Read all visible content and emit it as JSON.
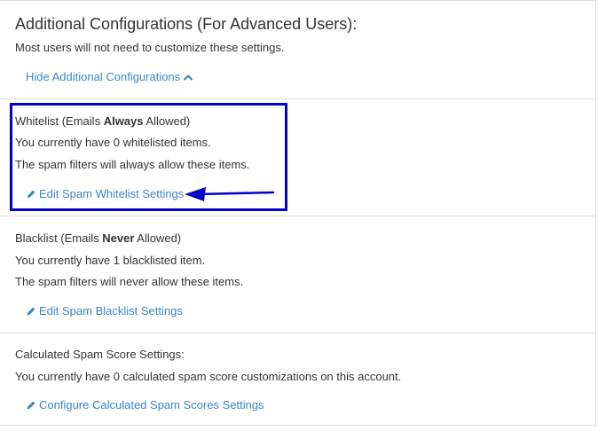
{
  "header": {
    "title": "Additional Configurations (For Advanced Users):",
    "description": "Most users will not need to customize these settings.",
    "toggle_link": "Hide Additional Configurations"
  },
  "whitelist": {
    "heading_pre": "Whitelist (Emails ",
    "heading_bold": "Always",
    "heading_post": " Allowed)",
    "count_text": "You currently have 0 whitelisted items.",
    "info_text": "The spam filters will always allow these items.",
    "link": "Edit Spam Whitelist Settings"
  },
  "blacklist": {
    "heading_pre": "Blacklist (Emails ",
    "heading_bold": "Never",
    "heading_post": " Allowed)",
    "count_text": "You currently have 1 blacklisted item.",
    "info_text": "The spam filters will never allow these items.",
    "link": "Edit Spam Blacklist Settings"
  },
  "calculated": {
    "heading": "Calculated Spam Score Settings:",
    "count_text": "You currently have 0 calculated spam score customizations on this account.",
    "link": "Configure Calculated Spam Scores Settings"
  },
  "icons": {
    "toggle": "chevron-up-icon",
    "edit": "pencil-icon"
  },
  "colors": {
    "link": "#3a87c8",
    "highlight": "#0000cc",
    "text": "#333333",
    "divider": "#dddddd"
  }
}
